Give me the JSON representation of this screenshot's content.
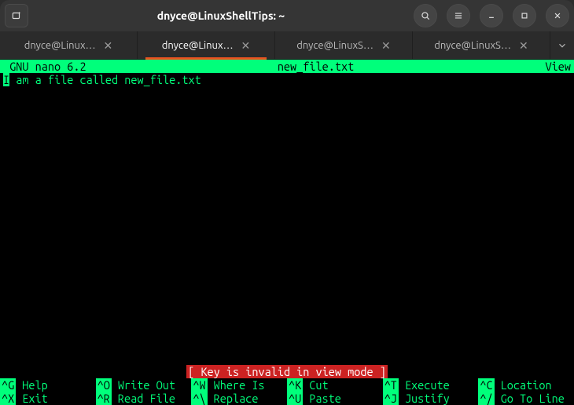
{
  "titlebar": {
    "title": "dnyce@LinuxShellTips: ~"
  },
  "tabs": [
    {
      "label": "dnyce@Linux…",
      "active": false
    },
    {
      "label": "dnyce@Linux…",
      "active": true
    },
    {
      "label": "dnyce@LinuxS…",
      "active": false
    },
    {
      "label": "dnyce@LinuxS…",
      "active": false
    }
  ],
  "nano": {
    "version": " GNU nano 6.2",
    "filename": "new_file.txt",
    "mode": "View",
    "cursor_char": "I",
    "content": " am a file called new_file.txt",
    "status_message": "[ Key is invalid in view mode ]",
    "help_row1": [
      {
        "key": "^G",
        "label": "Help"
      },
      {
        "key": "^O",
        "label": "Write Out"
      },
      {
        "key": "^W",
        "label": "Where Is"
      },
      {
        "key": "^K",
        "label": "Cut"
      },
      {
        "key": "^T",
        "label": "Execute"
      },
      {
        "key": "^C",
        "label": "Location"
      }
    ],
    "help_row2": [
      {
        "key": "^X",
        "label": "Exit"
      },
      {
        "key": "^R",
        "label": "Read File"
      },
      {
        "key": "^\\",
        "label": "Replace"
      },
      {
        "key": "^U",
        "label": "Paste"
      },
      {
        "key": "^J",
        "label": "Justify"
      },
      {
        "key": "^/",
        "label": "Go To Line"
      }
    ]
  }
}
